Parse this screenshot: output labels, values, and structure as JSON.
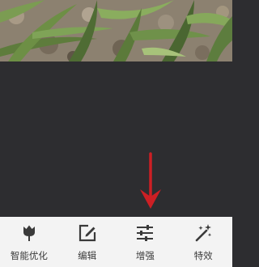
{
  "photo": {
    "subject": "grass-and-soil-photo"
  },
  "annotation": {
    "arrow_color": "#cc1f24",
    "icon": "arrow-down-icon"
  },
  "toolbar": {
    "items": [
      {
        "label": "智能优化",
        "icon": "tulip-icon"
      },
      {
        "label": "编辑",
        "icon": "edit-icon"
      },
      {
        "label": "增强",
        "icon": "sliders-icon"
      },
      {
        "label": "特效",
        "icon": "magic-wand-icon"
      }
    ]
  },
  "colors": {
    "toolbar_bg": "#f3f3f3",
    "canvas_bg": "#2d2d30",
    "icon": "#3a3a3a"
  }
}
